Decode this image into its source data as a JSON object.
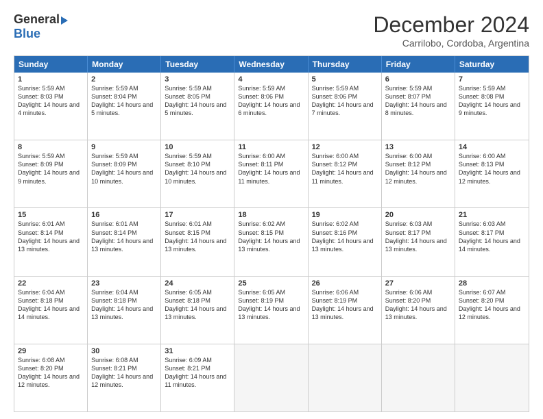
{
  "logo": {
    "general": "General",
    "blue": "Blue"
  },
  "title": "December 2024",
  "location": "Carrilobo, Cordoba, Argentina",
  "days_of_week": [
    "Sunday",
    "Monday",
    "Tuesday",
    "Wednesday",
    "Thursday",
    "Friday",
    "Saturday"
  ],
  "weeks": [
    [
      {
        "day": "1",
        "sunrise": "5:59 AM",
        "sunset": "8:03 PM",
        "daylight": "14 hours and 4 minutes."
      },
      {
        "day": "2",
        "sunrise": "5:59 AM",
        "sunset": "8:04 PM",
        "daylight": "14 hours and 5 minutes."
      },
      {
        "day": "3",
        "sunrise": "5:59 AM",
        "sunset": "8:05 PM",
        "daylight": "14 hours and 5 minutes."
      },
      {
        "day": "4",
        "sunrise": "5:59 AM",
        "sunset": "8:06 PM",
        "daylight": "14 hours and 6 minutes."
      },
      {
        "day": "5",
        "sunrise": "5:59 AM",
        "sunset": "8:06 PM",
        "daylight": "14 hours and 7 minutes."
      },
      {
        "day": "6",
        "sunrise": "5:59 AM",
        "sunset": "8:07 PM",
        "daylight": "14 hours and 8 minutes."
      },
      {
        "day": "7",
        "sunrise": "5:59 AM",
        "sunset": "8:08 PM",
        "daylight": "14 hours and 9 minutes."
      }
    ],
    [
      {
        "day": "8",
        "sunrise": "5:59 AM",
        "sunset": "8:09 PM",
        "daylight": "14 hours and 9 minutes."
      },
      {
        "day": "9",
        "sunrise": "5:59 AM",
        "sunset": "8:09 PM",
        "daylight": "14 hours and 10 minutes."
      },
      {
        "day": "10",
        "sunrise": "5:59 AM",
        "sunset": "8:10 PM",
        "daylight": "14 hours and 10 minutes."
      },
      {
        "day": "11",
        "sunrise": "6:00 AM",
        "sunset": "8:11 PM",
        "daylight": "14 hours and 11 minutes."
      },
      {
        "day": "12",
        "sunrise": "6:00 AM",
        "sunset": "8:12 PM",
        "daylight": "14 hours and 11 minutes."
      },
      {
        "day": "13",
        "sunrise": "6:00 AM",
        "sunset": "8:12 PM",
        "daylight": "14 hours and 12 minutes."
      },
      {
        "day": "14",
        "sunrise": "6:00 AM",
        "sunset": "8:13 PM",
        "daylight": "14 hours and 12 minutes."
      }
    ],
    [
      {
        "day": "15",
        "sunrise": "6:01 AM",
        "sunset": "8:14 PM",
        "daylight": "14 hours and 13 minutes."
      },
      {
        "day": "16",
        "sunrise": "6:01 AM",
        "sunset": "8:14 PM",
        "daylight": "14 hours and 13 minutes."
      },
      {
        "day": "17",
        "sunrise": "6:01 AM",
        "sunset": "8:15 PM",
        "daylight": "14 hours and 13 minutes."
      },
      {
        "day": "18",
        "sunrise": "6:02 AM",
        "sunset": "8:15 PM",
        "daylight": "14 hours and 13 minutes."
      },
      {
        "day": "19",
        "sunrise": "6:02 AM",
        "sunset": "8:16 PM",
        "daylight": "14 hours and 13 minutes."
      },
      {
        "day": "20",
        "sunrise": "6:03 AM",
        "sunset": "8:17 PM",
        "daylight": "14 hours and 13 minutes."
      },
      {
        "day": "21",
        "sunrise": "6:03 AM",
        "sunset": "8:17 PM",
        "daylight": "14 hours and 14 minutes."
      }
    ],
    [
      {
        "day": "22",
        "sunrise": "6:04 AM",
        "sunset": "8:18 PM",
        "daylight": "14 hours and 14 minutes."
      },
      {
        "day": "23",
        "sunrise": "6:04 AM",
        "sunset": "8:18 PM",
        "daylight": "14 hours and 13 minutes."
      },
      {
        "day": "24",
        "sunrise": "6:05 AM",
        "sunset": "8:18 PM",
        "daylight": "14 hours and 13 minutes."
      },
      {
        "day": "25",
        "sunrise": "6:05 AM",
        "sunset": "8:19 PM",
        "daylight": "14 hours and 13 minutes."
      },
      {
        "day": "26",
        "sunrise": "6:06 AM",
        "sunset": "8:19 PM",
        "daylight": "14 hours and 13 minutes."
      },
      {
        "day": "27",
        "sunrise": "6:06 AM",
        "sunset": "8:20 PM",
        "daylight": "14 hours and 13 minutes."
      },
      {
        "day": "28",
        "sunrise": "6:07 AM",
        "sunset": "8:20 PM",
        "daylight": "14 hours and 12 minutes."
      }
    ],
    [
      {
        "day": "29",
        "sunrise": "6:08 AM",
        "sunset": "8:20 PM",
        "daylight": "14 hours and 12 minutes."
      },
      {
        "day": "30",
        "sunrise": "6:08 AM",
        "sunset": "8:21 PM",
        "daylight": "14 hours and 12 minutes."
      },
      {
        "day": "31",
        "sunrise": "6:09 AM",
        "sunset": "8:21 PM",
        "daylight": "14 hours and 11 minutes."
      },
      null,
      null,
      null,
      null
    ]
  ]
}
